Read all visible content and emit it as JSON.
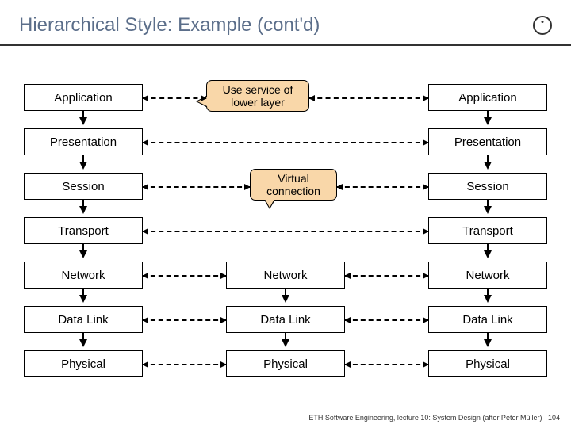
{
  "title": "Hierarchical Style: Example (cont'd)",
  "layers": {
    "left": [
      "Application",
      "Presentation",
      "Session",
      "Transport",
      "Network",
      "Data Link",
      "Physical"
    ],
    "middle": [
      "Network",
      "Data Link",
      "Physical"
    ],
    "right": [
      "Application",
      "Presentation",
      "Session",
      "Transport",
      "Network",
      "Data Link",
      "Physical"
    ]
  },
  "callouts": {
    "use_service": "Use service of\nlower layer",
    "virtual_conn": "Virtual\nconnection"
  },
  "footer": "ETH Software Engineering, lecture 10: System Design (after Peter Müller)",
  "page_number": "104"
}
